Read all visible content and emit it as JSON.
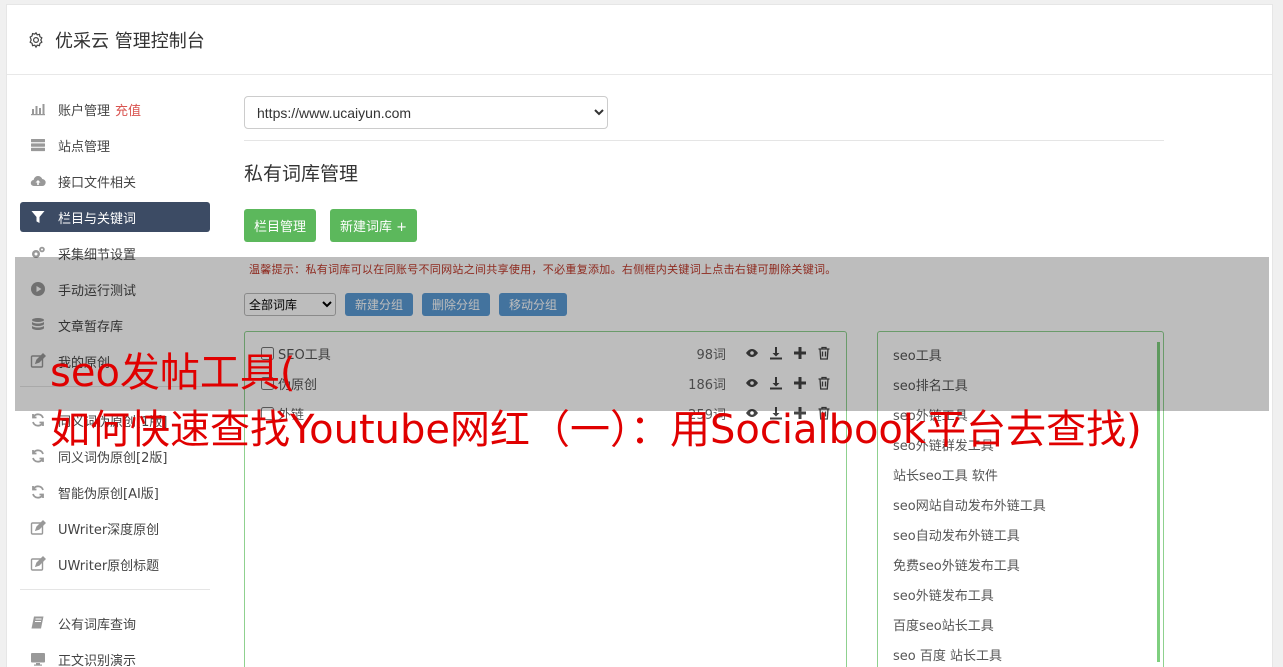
{
  "header": {
    "title": "优采云 管理控制台"
  },
  "sidebar": {
    "items": [
      {
        "label": "账户管理",
        "extra": "充值",
        "icon": "bar-chart-icon"
      },
      {
        "label": "站点管理",
        "icon": "server-icon"
      },
      {
        "label": "接口文件相关",
        "icon": "cloud-upload-icon"
      },
      {
        "label": "栏目与关键词",
        "icon": "filter-icon",
        "active": true
      },
      {
        "label": "采集细节设置",
        "icon": "cogs-icon"
      },
      {
        "label": "手动运行测试",
        "icon": "play-circle-icon"
      },
      {
        "label": "文章暂存库",
        "icon": "database-icon"
      },
      {
        "label": "我的原创",
        "icon": "edit-icon"
      },
      {
        "label": "同义词伪原创[1版]",
        "icon": "refresh-icon"
      },
      {
        "label": "同义词伪原创[2版]",
        "icon": "refresh-icon"
      },
      {
        "label": "智能伪原创[AI版]",
        "icon": "refresh-icon"
      },
      {
        "label": "UWriter深度原创",
        "icon": "edit-icon"
      },
      {
        "label": "UWriter原创标题",
        "icon": "edit-icon"
      },
      {
        "label": "公有词库查询",
        "icon": "book-icon"
      },
      {
        "label": "正文识别演示",
        "icon": "monitor-icon"
      }
    ]
  },
  "main": {
    "site_select": "https://www.ucaiyun.com",
    "page_title": "私有词库管理",
    "btn_column": "栏目管理",
    "btn_new_lib": "新建词库 +",
    "tip": "温馨提示：私有词库可以在同账号不同网站之间共享使用，不必重复添加。右侧框内关键词上点击右键可删除关键词。",
    "group_select": "全部词库",
    "btn_new_group": "新建分组",
    "btn_delete_group": "删除分组",
    "btn_move_group": "移动分组",
    "libraries": [
      {
        "name": "SEO工具",
        "count": "98词"
      },
      {
        "name": "伪原创",
        "count": "186词"
      },
      {
        "name": "外链",
        "count": "259词"
      }
    ],
    "keywords": [
      "seo工具",
      "seo排名工具",
      "seo外链工具",
      "seo外链群发工具",
      "站长seo工具 软件",
      "seo网站自动发布外链工具",
      "seo自动发布外链工具",
      "免费seo外链发布工具",
      "seo外链发布工具",
      "百度seo站长工具",
      "seo 百度 站长工具"
    ]
  },
  "overlay": {
    "line1": "seo发帖工具(",
    "line2": "如何快速查找Youtube网红（一）：用Socialbook平台去查找)"
  },
  "colors": {
    "active_nav": "#3c4b64",
    "green": "#5cb85c",
    "blue": "#5b9bd5",
    "overlay_text": "#e00000"
  }
}
